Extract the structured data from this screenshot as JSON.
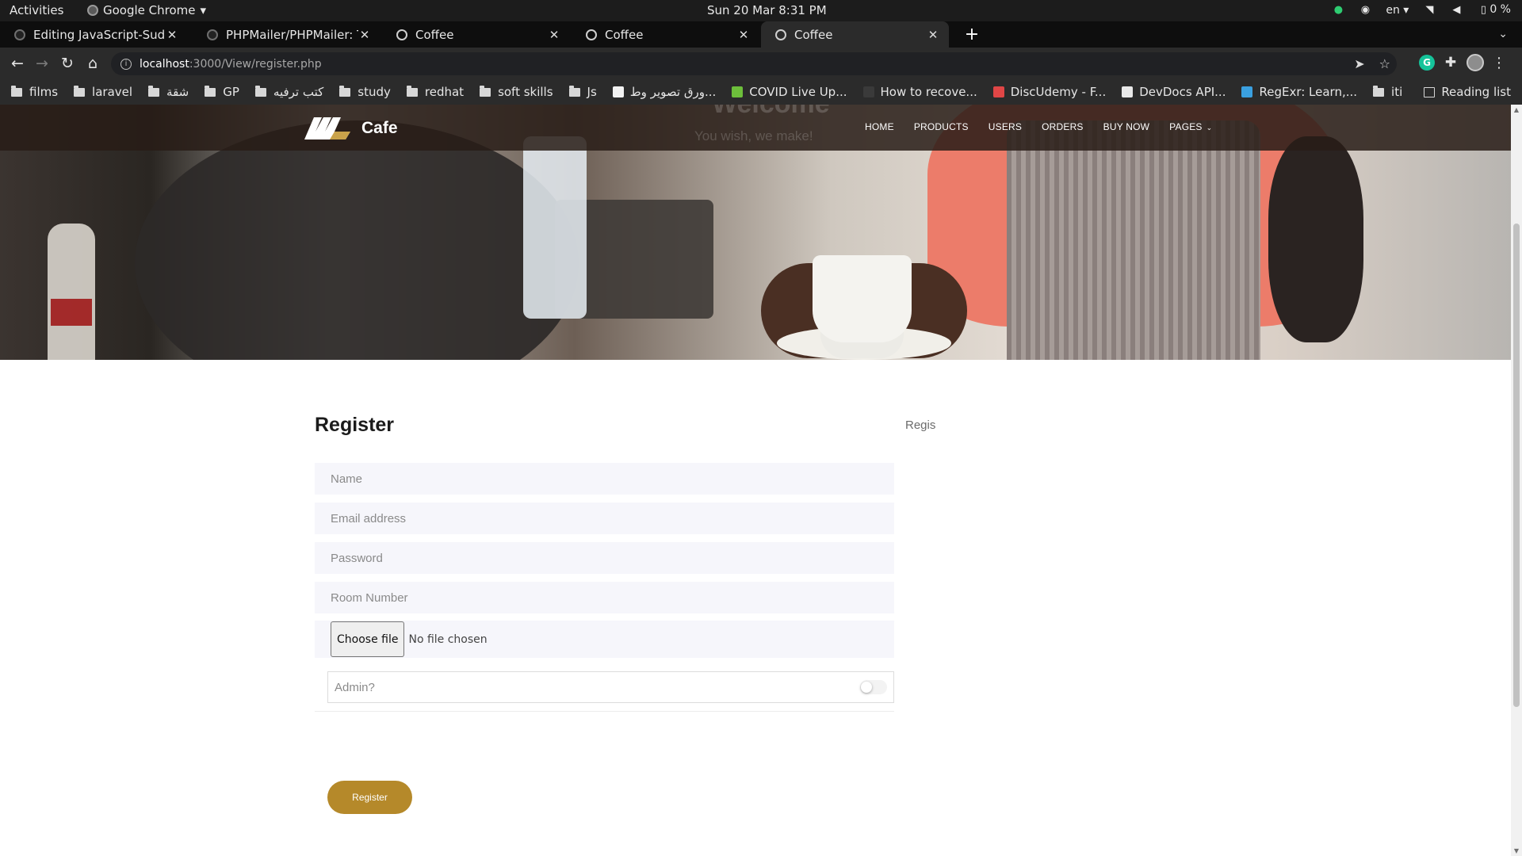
{
  "os_topbar": {
    "activities": "Activities",
    "app_name": "Google Chrome",
    "app_menu_caret": "▾",
    "clock": "Sun 20 Mar   8:31 PM",
    "lang": "en ▾",
    "battery": "0 %",
    "icons": [
      "whatsapp-icon",
      "discord-icon",
      "wifi-icon",
      "volume-icon",
      "battery-icon"
    ]
  },
  "tabs": [
    {
      "title": "Editing JavaScript-Sudok",
      "favicon": "github-icon",
      "active": false
    },
    {
      "title": "PHPMailer/PHPMailer: Th",
      "favicon": "github-icon",
      "active": false
    },
    {
      "title": "Coffee",
      "favicon": "globe-icon",
      "active": false
    },
    {
      "title": "Coffee",
      "favicon": "globe-icon",
      "active": false
    },
    {
      "title": "Coffee",
      "favicon": "globe-icon",
      "active": true
    }
  ],
  "tab_close_glyph": "✕",
  "new_tab_glyph": "+",
  "tab_menu_glyph": "⌄",
  "address_bar": {
    "host": "localhost",
    "path": ":3000/View/register.php"
  },
  "bookmarks": [
    {
      "label": "films",
      "type": "folder"
    },
    {
      "label": "laravel",
      "type": "folder"
    },
    {
      "label": "شقة",
      "type": "folder"
    },
    {
      "label": "GP",
      "type": "folder"
    },
    {
      "label": "كتب ترفيه",
      "type": "folder"
    },
    {
      "label": "study",
      "type": "folder"
    },
    {
      "label": "redhat",
      "type": "folder"
    },
    {
      "label": "soft skills",
      "type": "folder"
    },
    {
      "label": "Js",
      "type": "folder"
    },
    {
      "label": "ورق تصوير وط...",
      "type": "site",
      "color": "#f2f2f2"
    },
    {
      "label": "COVID Live Up...",
      "type": "site",
      "color": "#6dbf3b"
    },
    {
      "label": "How to recove...",
      "type": "site",
      "color": "#3a3a3a"
    },
    {
      "label": "DiscUdemy - F...",
      "type": "site",
      "color": "#e04646"
    },
    {
      "label": "DevDocs API...",
      "type": "site",
      "color": "#e8e8e8"
    },
    {
      "label": "RegExr: Learn,...",
      "type": "site",
      "color": "#3aa0e0"
    },
    {
      "label": "iti",
      "type": "folder"
    }
  ],
  "reading_list": "Reading list",
  "site": {
    "brand": "Cafe",
    "ghost_title": "Welcome",
    "ghost_subtitle": "You wish, we make!",
    "menu": [
      "HOME",
      "PRODUCTS",
      "USERS",
      "ORDERS",
      "BUY NOW",
      "PAGES"
    ],
    "pages_caret": "⌄"
  },
  "form": {
    "title": "Register",
    "side_text": "Regis",
    "name_placeholder": "Name",
    "email_placeholder": "Email address",
    "password_placeholder": "Password",
    "room_placeholder": "Room Number",
    "file_button": "Choose file",
    "file_status": "No file chosen",
    "admin_label": "Admin?",
    "admin_toggle_on": false,
    "submit_label": "Register"
  },
  "colors": {
    "accent_gold": "#b5892a",
    "site_nav_bg": "#281c16",
    "input_bg": "#f6f6fb"
  }
}
